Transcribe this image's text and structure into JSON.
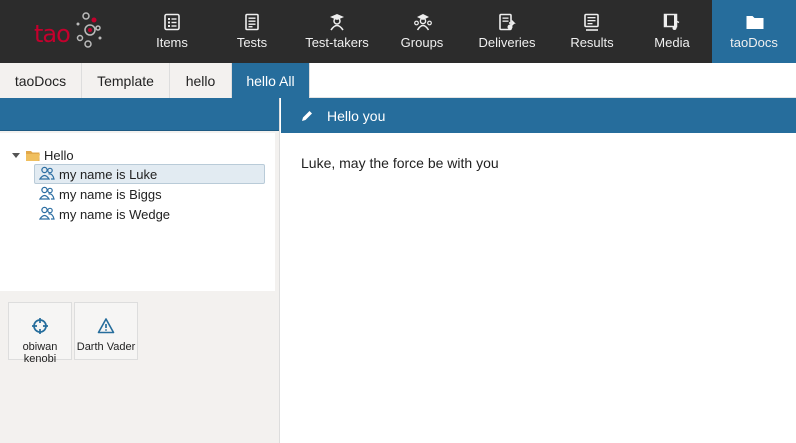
{
  "brand": {
    "logo_text": "tao"
  },
  "nav": {
    "items": [
      {
        "label": "Items",
        "icon": "items-icon"
      },
      {
        "label": "Tests",
        "icon": "tests-icon"
      },
      {
        "label": "Test-takers",
        "icon": "test-takers-icon"
      },
      {
        "label": "Groups",
        "icon": "groups-icon"
      },
      {
        "label": "Deliveries",
        "icon": "deliveries-icon"
      },
      {
        "label": "Results",
        "icon": "results-icon"
      },
      {
        "label": "Media",
        "icon": "media-icon"
      },
      {
        "label": "taoDocs",
        "icon": "folder-icon",
        "active": true
      }
    ]
  },
  "tabs": [
    {
      "label": "taoDocs"
    },
    {
      "label": "Template"
    },
    {
      "label": "hello"
    },
    {
      "label": "hello All",
      "active": true
    }
  ],
  "tree": {
    "root_label": "Hello",
    "items": [
      {
        "label": "my name is Luke",
        "selected": true
      },
      {
        "label": "my name is Biggs"
      },
      {
        "label": "my name is Wedge"
      }
    ]
  },
  "actions": [
    {
      "label": "obiwan kenobi",
      "icon": "crosshair-icon"
    },
    {
      "label": "Darth Vader",
      "icon": "warning-icon"
    }
  ],
  "content": {
    "header": "Hello you",
    "header_icon": "pencil-icon",
    "body": "Luke, may the force be with you"
  },
  "colors": {
    "accent": "#266d9c",
    "topbar": "#2c2c2c",
    "panel": "#f3f1ef",
    "logo": "#c4002d"
  }
}
